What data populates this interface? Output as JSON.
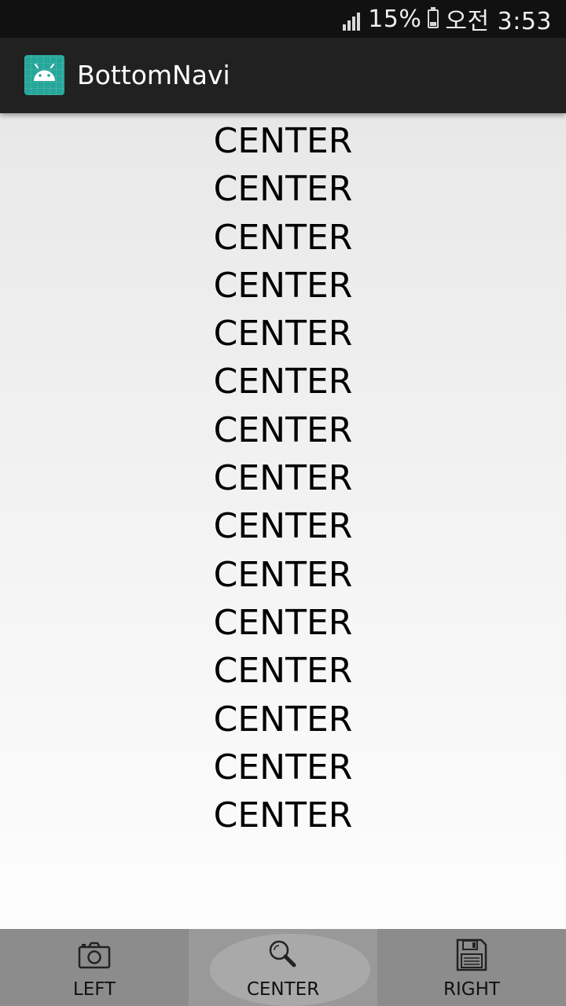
{
  "status_bar": {
    "battery": "15%",
    "time": "오전 3:53"
  },
  "app_bar": {
    "title": "BottomNavi",
    "icon": "android-icon",
    "icon_color": "#26a69a"
  },
  "content": {
    "items": [
      "CENTER",
      "CENTER",
      "CENTER",
      "CENTER",
      "CENTER",
      "CENTER",
      "CENTER",
      "CENTER",
      "CENTER",
      "CENTER",
      "CENTER",
      "CENTER",
      "CENTER",
      "CENTER",
      "CENTER"
    ]
  },
  "bottom_nav": {
    "background": "#8c8c8c",
    "selected": "center",
    "items": [
      {
        "label": "LEFT",
        "icon": "camera-icon"
      },
      {
        "label": "CENTER",
        "icon": "search-icon"
      },
      {
        "label": "RIGHT",
        "icon": "save-icon"
      }
    ]
  }
}
